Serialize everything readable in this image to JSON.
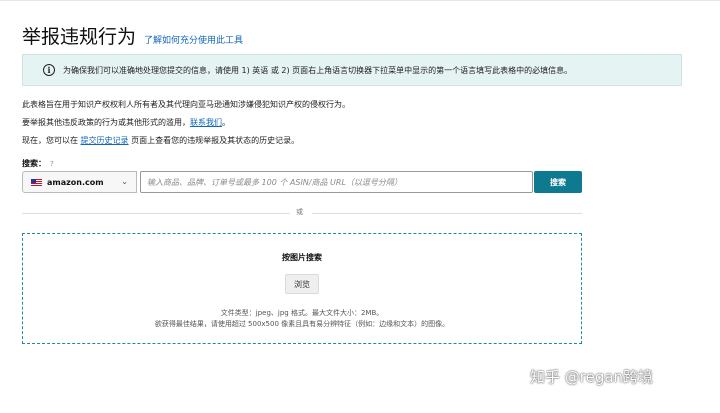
{
  "header": {
    "title": "举报违规行为",
    "help_link": "了解如何充分使用此工具"
  },
  "info_banner": {
    "icon": "info-icon",
    "icon_glyph": "i",
    "text": "为确保我们可以准确地处理您提交的信息，请使用 1) 英语 或 2) 页面右上角语言切换器下拉菜单中显示的第一个语言填写此表格中的必填信息。"
  },
  "intro": {
    "line1": "此表格旨在用于知识产权权利人所有者及其代理向亚马逊通知涉嫌侵犯知识产权的侵权行为。",
    "line2_prefix": "要举报其他违反政策的行为或其他形式的滥用，",
    "line2_link": "联系我们",
    "line2_suffix": "。",
    "line3_prefix": "现在，您可以在",
    "line3_link": "提交历史记录",
    "line3_suffix": "页面上查看您的违规举报及其状态的历史记录。"
  },
  "search": {
    "label": "搜索：",
    "help_glyph": "?",
    "marketplace": "amazon.com",
    "chevron_glyph": "⌄",
    "placeholder": "输入商品、品牌、订单号或最多 100 个 ASIN/商品 URL（以逗号分隔）",
    "button_label": "搜索"
  },
  "separator": {
    "text": "或"
  },
  "image_search": {
    "title": "按图片搜索",
    "browse_label": "浏览",
    "hint_line1": "文件类型：jpeg、jpg 格式。最大文件大小：2MB。",
    "hint_line2": "欲获得最佳结果，请使用超过 500x500 像素且具有易分辨特征（例如：边缘和文本）的图像。"
  },
  "watermark": {
    "text": "知乎 @regan跨境"
  },
  "colors": {
    "accent": "#0e7a90",
    "link": "#1166bb",
    "banner_bg": "#e6f3f3",
    "dropzone_border": "#1e8a9c"
  }
}
